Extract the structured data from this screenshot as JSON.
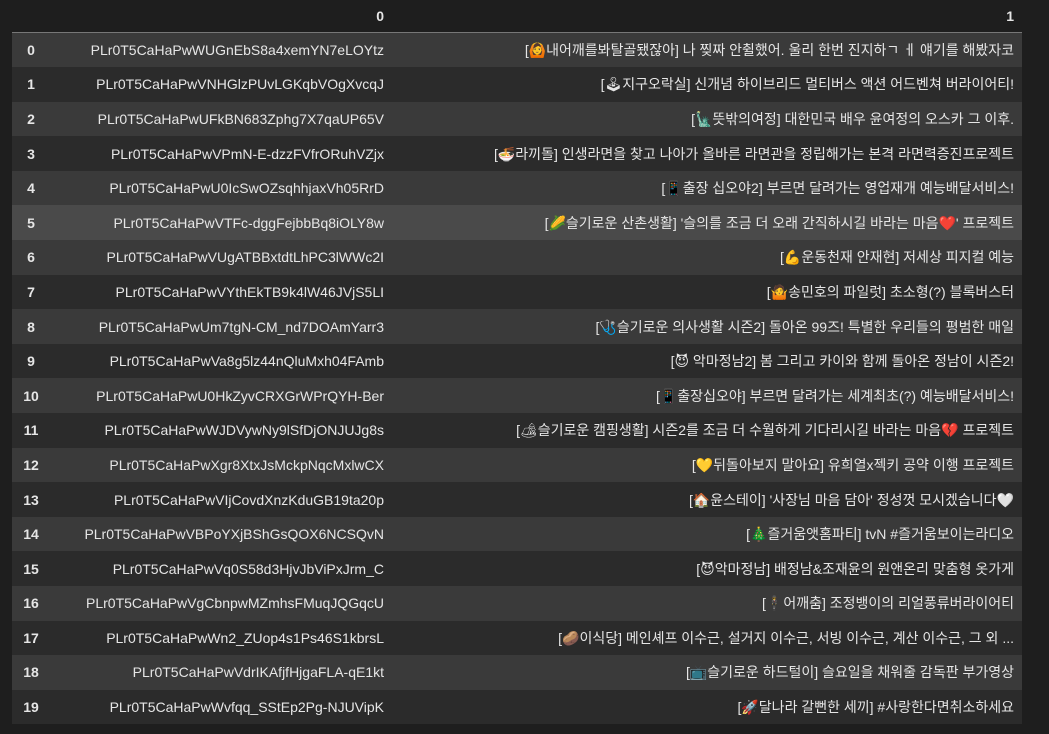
{
  "columns": [
    "",
    "0",
    "1"
  ],
  "rows": [
    {
      "index": "0",
      "id": "PLr0T5CaHaPwWUGnEbS8a4xemYN7eLOYtz",
      "title": "[🙆내어깨를봐탈골됐잖아] 나 찢짜 안췰했어. 울리 한번 진지하ㄱ ㅔ 얘기를 해봤자코"
    },
    {
      "index": "1",
      "id": "PLr0T5CaHaPwVNHGlzPUvLGKqbVOgXvcqJ",
      "title": "[🕹지구오락실] 신개념 하이브리드 멀티버스 액션 어드벤쳐 버라이어티!"
    },
    {
      "index": "2",
      "id": "PLr0T5CaHaPwUFkBN683Zphg7X7qaUP65V",
      "title": "[🗽뜻밖의여정] 대한민국 배우 윤여정의 오스카 그 이후."
    },
    {
      "index": "3",
      "id": "PLr0T5CaHaPwVPmN-E-dzzFVfrORuhVZjx",
      "title": "[🍜라끼돌] 인생라면을 찾고 나아가 올바른 라면관을 정립해가는 본격 라면력증진프로젝트"
    },
    {
      "index": "4",
      "id": "PLr0T5CaHaPwU0IcSwOZsqhhjaxVh05RrD",
      "title": "[📱출장 십오야2] 부르면 달려가는 영업재개 예능배달서비스!"
    },
    {
      "index": "5",
      "id": "PLr0T5CaHaPwVTFc-dggFejbbBq8iOLY8w",
      "title": "[🌽슬기로운 산촌생활] '슬의를 조금 더 오래 간직하시길 바라는 마음❤️' 프로젝트"
    },
    {
      "index": "6",
      "id": "PLr0T5CaHaPwVUgATBBxtdtLhPC3lWWc2I",
      "title": "[💪운동천재 안재현] 저세상 피지컬 예능"
    },
    {
      "index": "7",
      "id": "PLr0T5CaHaPwVYthEkTB9k4lW46JVjS5LI",
      "title": "[🤷송민호의 파일럿] 초소형(?) 블록버스터"
    },
    {
      "index": "8",
      "id": "PLr0T5CaHaPwUm7tgN-CM_nd7DOAmYarr3",
      "title": "[🩺슬기로운 의사생활 시즌2] 돌아온 99즈! 특별한 우리들의 평범한 매일"
    },
    {
      "index": "9",
      "id": "PLr0T5CaHaPwVa8g5lz44nQluMxh04FAmb",
      "title": "[😈 악마정남2] 봄 그리고 카이와 함께 돌아온 정남이 시즌2!"
    },
    {
      "index": "10",
      "id": "PLr0T5CaHaPwU0HkZyvCRXGrWPrQYH-Ber",
      "title": "[📱출장십오야] 부르면 달려가는 세계최초(?) 예능배달서비스!"
    },
    {
      "index": "11",
      "id": "PLr0T5CaHaPwWJDVywNy9lSfDjONJUJg8s",
      "title": "[🏕슬기로운 캠핑생활] 시즌2를 조금 더 수월하게 기다리시길 바라는 마음💔 프로젝트"
    },
    {
      "index": "12",
      "id": "PLr0T5CaHaPwXgr8XtxJsMckpNqcMxlwCX",
      "title": "[💛뒤돌아보지 말아요] 유희열x젝키 공약 이행 프로젝트"
    },
    {
      "index": "13",
      "id": "PLr0T5CaHaPwVIjCovdXnzKduGB19ta20p",
      "title": "[🏠윤스테이] '사장님 마음 담아' 정성껏 모시겠습니다🤍"
    },
    {
      "index": "14",
      "id": "PLr0T5CaHaPwVBPoYXjBShGsQOX6NCSQvN",
      "title": "[🎄즐거움앳홈파티] tvN #즐거움보이는라디오"
    },
    {
      "index": "15",
      "id": "PLr0T5CaHaPwVq0S58d3HjvJbViPxJrm_C",
      "title": "[😈악마정남] 배정남&조재윤의 원앤온리 맞춤형 옷가게"
    },
    {
      "index": "16",
      "id": "PLr0T5CaHaPwVgCbnpwMZmhsFMuqJQGqcU",
      "title": "[🕴어깨춤] 조정뱅이의 리얼풍류버라이어티"
    },
    {
      "index": "17",
      "id": "PLr0T5CaHaPwWn2_ZUop4s1Ps46S1kbrsL",
      "title": "[🥔이식당] 메인셰프 이수근, 설거지 이수근, 서빙 이수근, 계산 이수근, 그 외 ..."
    },
    {
      "index": "18",
      "id": "PLr0T5CaHaPwVdrIKAfjfHjgaFLA-qE1kt",
      "title": "[📺슬기로운 하드털이] 슬요일을 채워줄 감독판 부가영상"
    },
    {
      "index": "19",
      "id": "PLr0T5CaHaPwWvfqq_SStEp2Pg-NJUVipK",
      "title": "[🚀달나라 갈뻔한 세끼] #사랑한다면취소하세요"
    }
  ]
}
